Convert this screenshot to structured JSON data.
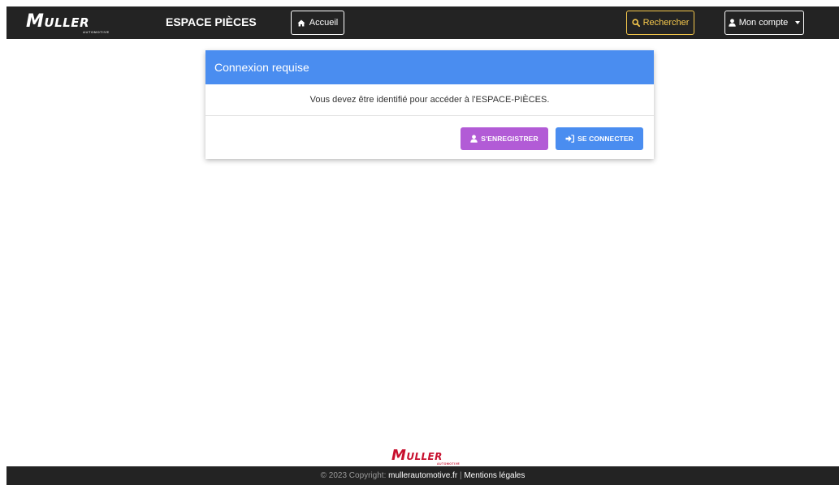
{
  "navbar": {
    "brand": {
      "initial": "M",
      "rest": "ULLER",
      "sub": "AUTOMOTIVE"
    },
    "title": "ESPACE PIÈCES",
    "home_button": {
      "icon": "home-icon",
      "label": "Accueil"
    },
    "search_button": {
      "icon": "search-icon",
      "label": "Rechercher",
      "color": "#f6c84c"
    },
    "account_button": {
      "icon": "user-icon",
      "label": "Mon compte"
    },
    "background": "#232323"
  },
  "login_card": {
    "header": "Connexion requise",
    "header_color": "#4a8df0",
    "message": "Vous devez être identifié pour accéder à l'ESPACE-PIÈCES.",
    "register_button": {
      "icon": "user-icon",
      "label": "S'ENREGISTRER",
      "color": "#b25bd6"
    },
    "login_button": {
      "icon": "sign-in-icon",
      "label": "SE CONNECTER",
      "color": "#4a8df0"
    }
  },
  "footer": {
    "logo": {
      "initial": "M",
      "rest": "ULLER",
      "sub": "AUTOMOTIVE",
      "color": "#c8102e"
    },
    "copyright": "© 2023 Copyright: ",
    "site_link": "mullerautomotive.fr",
    "separator": " | ",
    "legal_link": "Mentions légales"
  }
}
